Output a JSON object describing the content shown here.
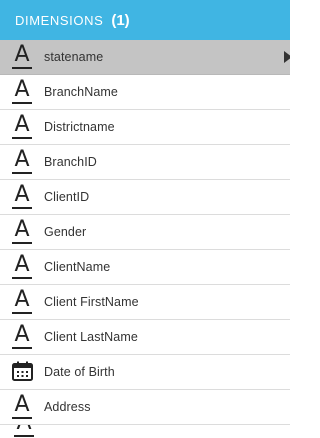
{
  "header": {
    "title": "DIMENSIONS",
    "count": "(1)"
  },
  "items": [
    {
      "label": "statename",
      "icon": "text-icon",
      "selected": true
    },
    {
      "label": "BranchName",
      "icon": "text-icon"
    },
    {
      "label": "Districtname",
      "icon": "text-icon"
    },
    {
      "label": "BranchID",
      "icon": "text-icon"
    },
    {
      "label": "ClientID",
      "icon": "text-icon"
    },
    {
      "label": "Gender",
      "icon": "text-icon"
    },
    {
      "label": "ClientName",
      "icon": "text-icon"
    },
    {
      "label": "Client FirstName",
      "icon": "text-icon"
    },
    {
      "label": "Client LastName",
      "icon": "text-icon"
    },
    {
      "label": "Date of Birth",
      "icon": "calendar-icon"
    },
    {
      "label": "Address",
      "icon": "text-icon"
    }
  ],
  "icon_glyph": "A",
  "colors": {
    "header_bg": "#40b5e3",
    "selected_bg": "#c4c4c4"
  }
}
